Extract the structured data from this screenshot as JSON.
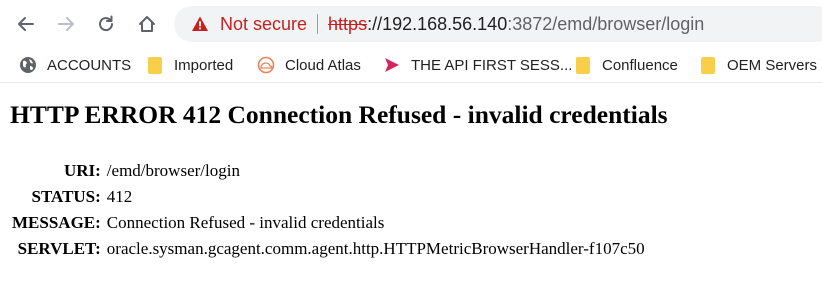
{
  "browser": {
    "security_label": "Not secure",
    "url": {
      "scheme": "https",
      "rest": "://192.168.56.140",
      "port": ":3872",
      "path": "/emd/browser/login"
    },
    "nav_icons": [
      "back-icon",
      "forward-icon",
      "reload-icon",
      "home-icon"
    ],
    "security_icon": "warning-icon",
    "colors": {
      "not_secure": "#c5221f",
      "omnibox_bg": "#f1f3f4",
      "folder": "#f9cf4a"
    }
  },
  "bookmarks": [
    {
      "label": "ACCOUNTS",
      "icon": "globe-icon"
    },
    {
      "label": "Imported",
      "icon": "folder-icon"
    },
    {
      "label": "Cloud Atlas",
      "icon": "cloud-atlas-icon"
    },
    {
      "label": "THE API FIRST SESS...",
      "icon": "api-play-icon"
    },
    {
      "label": "Confluence",
      "icon": "folder-icon"
    },
    {
      "label": "OEM Servers",
      "icon": "folder-icon"
    }
  ],
  "page": {
    "heading": "HTTP ERROR 412 Connection Refused - invalid credentials",
    "details": [
      {
        "key": "URI:",
        "value": "/emd/browser/login"
      },
      {
        "key": "STATUS:",
        "value": "412"
      },
      {
        "key": "MESSAGE:",
        "value": "Connection Refused - invalid credentials"
      },
      {
        "key": "SERVLET:",
        "value": "oracle.sysman.gcagent.comm.agent.http.HTTPMetricBrowserHandler-f107c50"
      }
    ]
  }
}
